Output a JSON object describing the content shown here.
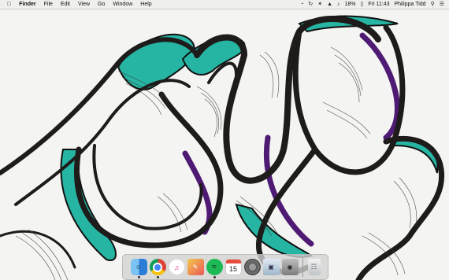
{
  "menubar": {
    "apple_icon": "apple-icon",
    "app_name": "Finder",
    "menus": [
      "File",
      "Edit",
      "View",
      "Go",
      "Window",
      "Help"
    ],
    "battery": "18%",
    "clock": "Fri 11:43",
    "user": "Philippa Tidd"
  },
  "dock": {
    "calendar_day": "15",
    "apps": [
      "finder",
      "chrome",
      "itunes",
      "photo-editor",
      "spotify",
      "calendar",
      "system-preferences",
      "preview",
      "image-capture",
      "trash"
    ]
  },
  "colors": {
    "teal": "#25b6a4",
    "purple": "#5a1b7e",
    "ink": "#1e1b1b"
  }
}
